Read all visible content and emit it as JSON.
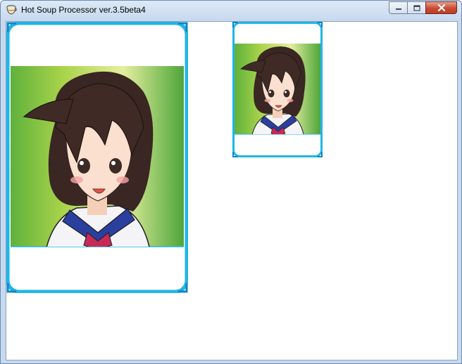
{
  "window": {
    "title": "Hot Soup Processor ver.3.5beta4"
  },
  "icons": {
    "app": "hsp-cup-icon",
    "minimize": "minimize-icon",
    "maximize": "maximize-icon",
    "close": "close-icon"
  },
  "colors": {
    "card_border": "#1fb6e8",
    "card_background_green": "#5fb63a",
    "close_button": "#c74a31"
  }
}
